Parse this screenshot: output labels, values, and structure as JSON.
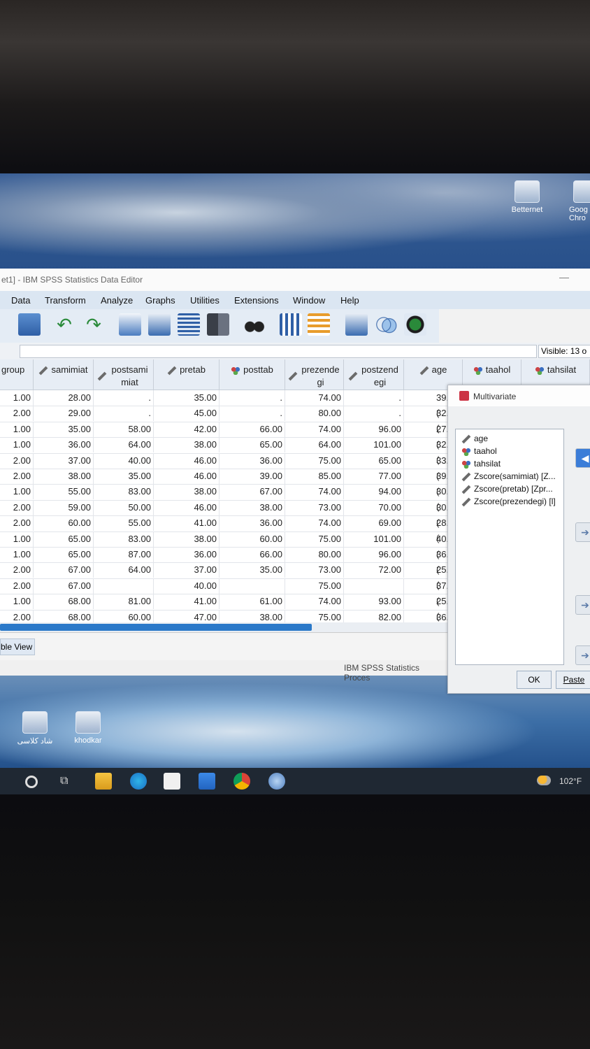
{
  "desktop": {
    "icons_top": [
      {
        "label": "Betternet"
      },
      {
        "label": "Goog\nChro"
      }
    ],
    "icons_bottom": [
      {
        "label": "شاد کلاسی"
      },
      {
        "label": "khodkar"
      }
    ]
  },
  "window": {
    "title": "et1] - IBM SPSS Statistics Data Editor",
    "minimize": "—"
  },
  "menu": [
    "Data",
    "Transform",
    "Analyze",
    "Graphs",
    "Utilities",
    "Extensions",
    "Window",
    "Help"
  ],
  "toolbar_icons": [
    "open-data-icon",
    "undo-icon",
    "redo-icon",
    "goto-case-icon",
    "goto-variable-icon",
    "variables-icon",
    "run-descriptives-icon",
    "find-icon",
    "insert-cases-icon",
    "insert-variable-icon",
    "split-file-icon",
    "weight-cases-icon",
    "select-cases-icon",
    "value-labels-icon",
    "use-sets-icon"
  ],
  "status": {
    "visible": "Visible: 13 o",
    "processor": "IBM SPSS Statistics Proces"
  },
  "view_tab": "ble View",
  "grid": {
    "columns": [
      {
        "label": "group",
        "type": "ruler"
      },
      {
        "label": "samimiat",
        "type": "ruler"
      },
      {
        "label": "postsami miat",
        "type": "ruler"
      },
      {
        "label": "pretab",
        "type": "ruler"
      },
      {
        "label": "posttab",
        "type": "nominal"
      },
      {
        "label": "prezende gi",
        "type": "ruler"
      },
      {
        "label": "postzend egi",
        "type": "ruler"
      },
      {
        "label": "age",
        "type": "ruler"
      },
      {
        "label": "taahol",
        "type": "nominal"
      },
      {
        "label": "tahsilat",
        "type": "nominal"
      }
    ],
    "rows": [
      [
        "1.00",
        "28.00",
        ".",
        "35.00",
        ".",
        "74.00",
        ".",
        "39.("
      ],
      [
        "2.00",
        "29.00",
        ".",
        "45.00",
        ".",
        "80.00",
        ".",
        "32.("
      ],
      [
        "1.00",
        "35.00",
        "58.00",
        "42.00",
        "66.00",
        "74.00",
        "96.00",
        "27.("
      ],
      [
        "1.00",
        "36.00",
        "64.00",
        "38.00",
        "65.00",
        "64.00",
        "101.00",
        "32.("
      ],
      [
        "2.00",
        "37.00",
        "40.00",
        "46.00",
        "36.00",
        "75.00",
        "65.00",
        "33.("
      ],
      [
        "2.00",
        "38.00",
        "35.00",
        "46.00",
        "39.00",
        "85.00",
        "77.00",
        "39.("
      ],
      [
        "1.00",
        "55.00",
        "83.00",
        "38.00",
        "67.00",
        "74.00",
        "94.00",
        "30.("
      ],
      [
        "2.00",
        "59.00",
        "50.00",
        "46.00",
        "38.00",
        "73.00",
        "70.00",
        "30.("
      ],
      [
        "2.00",
        "60.00",
        "55.00",
        "41.00",
        "36.00",
        "74.00",
        "69.00",
        "28.("
      ],
      [
        "1.00",
        "65.00",
        "83.00",
        "38.00",
        "60.00",
        "75.00",
        "101.00",
        "40.("
      ],
      [
        "1.00",
        "65.00",
        "87.00",
        "36.00",
        "66.00",
        "80.00",
        "96.00",
        "36.("
      ],
      [
        "2.00",
        "67.00",
        "64.00",
        "37.00",
        "35.00",
        "73.00",
        "72.00",
        "25.("
      ],
      [
        "2.00",
        "67.00",
        "",
        "40.00",
        "",
        "75.00",
        "",
        "37.("
      ],
      [
        "1.00",
        "68.00",
        "81.00",
        "41.00",
        "61.00",
        "74.00",
        "93.00",
        "25.("
      ],
      [
        "2.00",
        "68.00",
        "60.00",
        "47.00",
        "38.00",
        "75.00",
        "82.00",
        "36.("
      ]
    ]
  },
  "dialog": {
    "title": "Multivariate",
    "variables": [
      {
        "label": "age",
        "type": "ruler"
      },
      {
        "label": "taahol",
        "type": "nominal"
      },
      {
        "label": "tahsilat",
        "type": "nominal"
      },
      {
        "label": "Zscore(samimiat) [Z...",
        "type": "ruler"
      },
      {
        "label": "Zscore(pretab) [Zpr...",
        "type": "ruler"
      },
      {
        "label": "Zscore(prezendegi) [l]",
        "type": "ruler"
      }
    ],
    "ok": "OK",
    "paste": "Paste"
  },
  "taskbar": {
    "temperature": "102°F"
  }
}
